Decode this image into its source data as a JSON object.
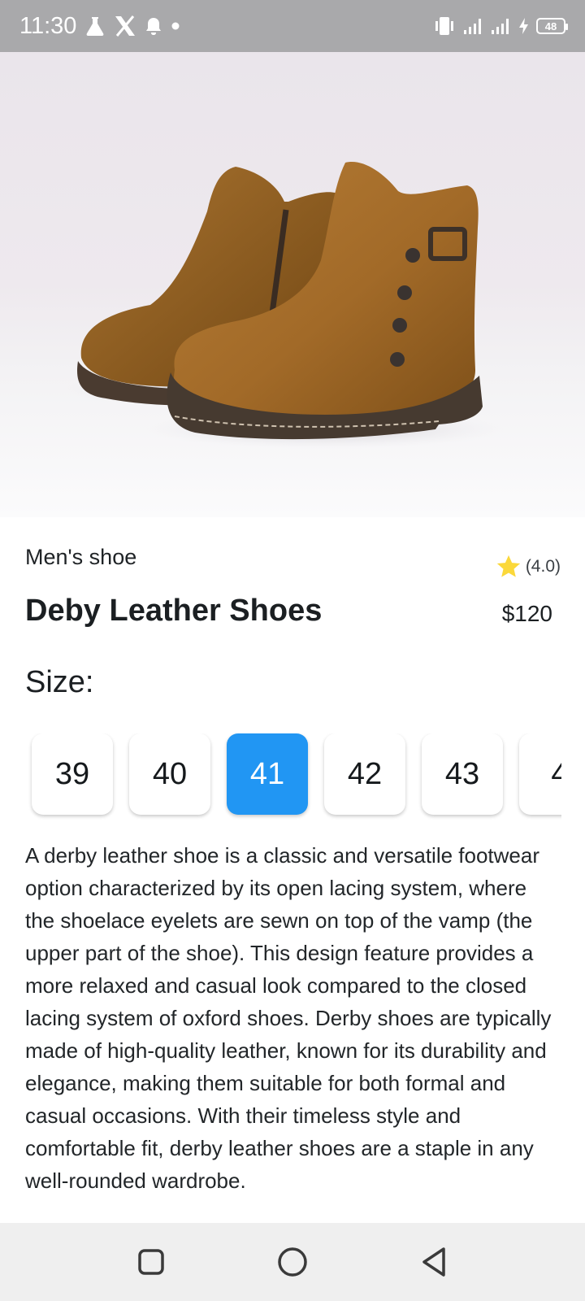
{
  "status_bar": {
    "time": "11:30",
    "battery": "48",
    "icons": [
      "flask-icon",
      "x-logo-icon",
      "notification-bell-icon",
      "dot-icon",
      "vibrate-icon",
      "signal-icon",
      "signal-icon",
      "charging-icon",
      "battery-icon"
    ]
  },
  "product": {
    "category": "Men's shoe",
    "rating": "(4.0)",
    "title": "Deby Leather Shoes",
    "price": "$120",
    "size_label": "Size:",
    "sizes": [
      "39",
      "40",
      "41",
      "42",
      "43",
      "4"
    ],
    "selected_size": "41",
    "description": "A derby leather shoe is a classic and versatile footwear option characterized by its open lacing system, where the shoelace eyelets are sewn on top of the vamp (the upper part of the shoe). This design feature provides a more relaxed and casual look compared to the closed lacing system of oxford shoes. Derby shoes are typically made of high-quality leather, known for its durability and elegance, making them suitable for both formal and casual occasions. With their timeless style and comfortable fit, derby leather shoes are a staple in any well-rounded wardrobe."
  },
  "colors": {
    "accent": "#2196f3",
    "star": "#fbd83a",
    "leather": "#a8702c",
    "status_bar": "#a9a9ab",
    "nav_bar": "#efefef"
  },
  "nav_bar": {
    "buttons": [
      "recents-square-icon",
      "home-circle-icon",
      "back-triangle-icon"
    ]
  }
}
